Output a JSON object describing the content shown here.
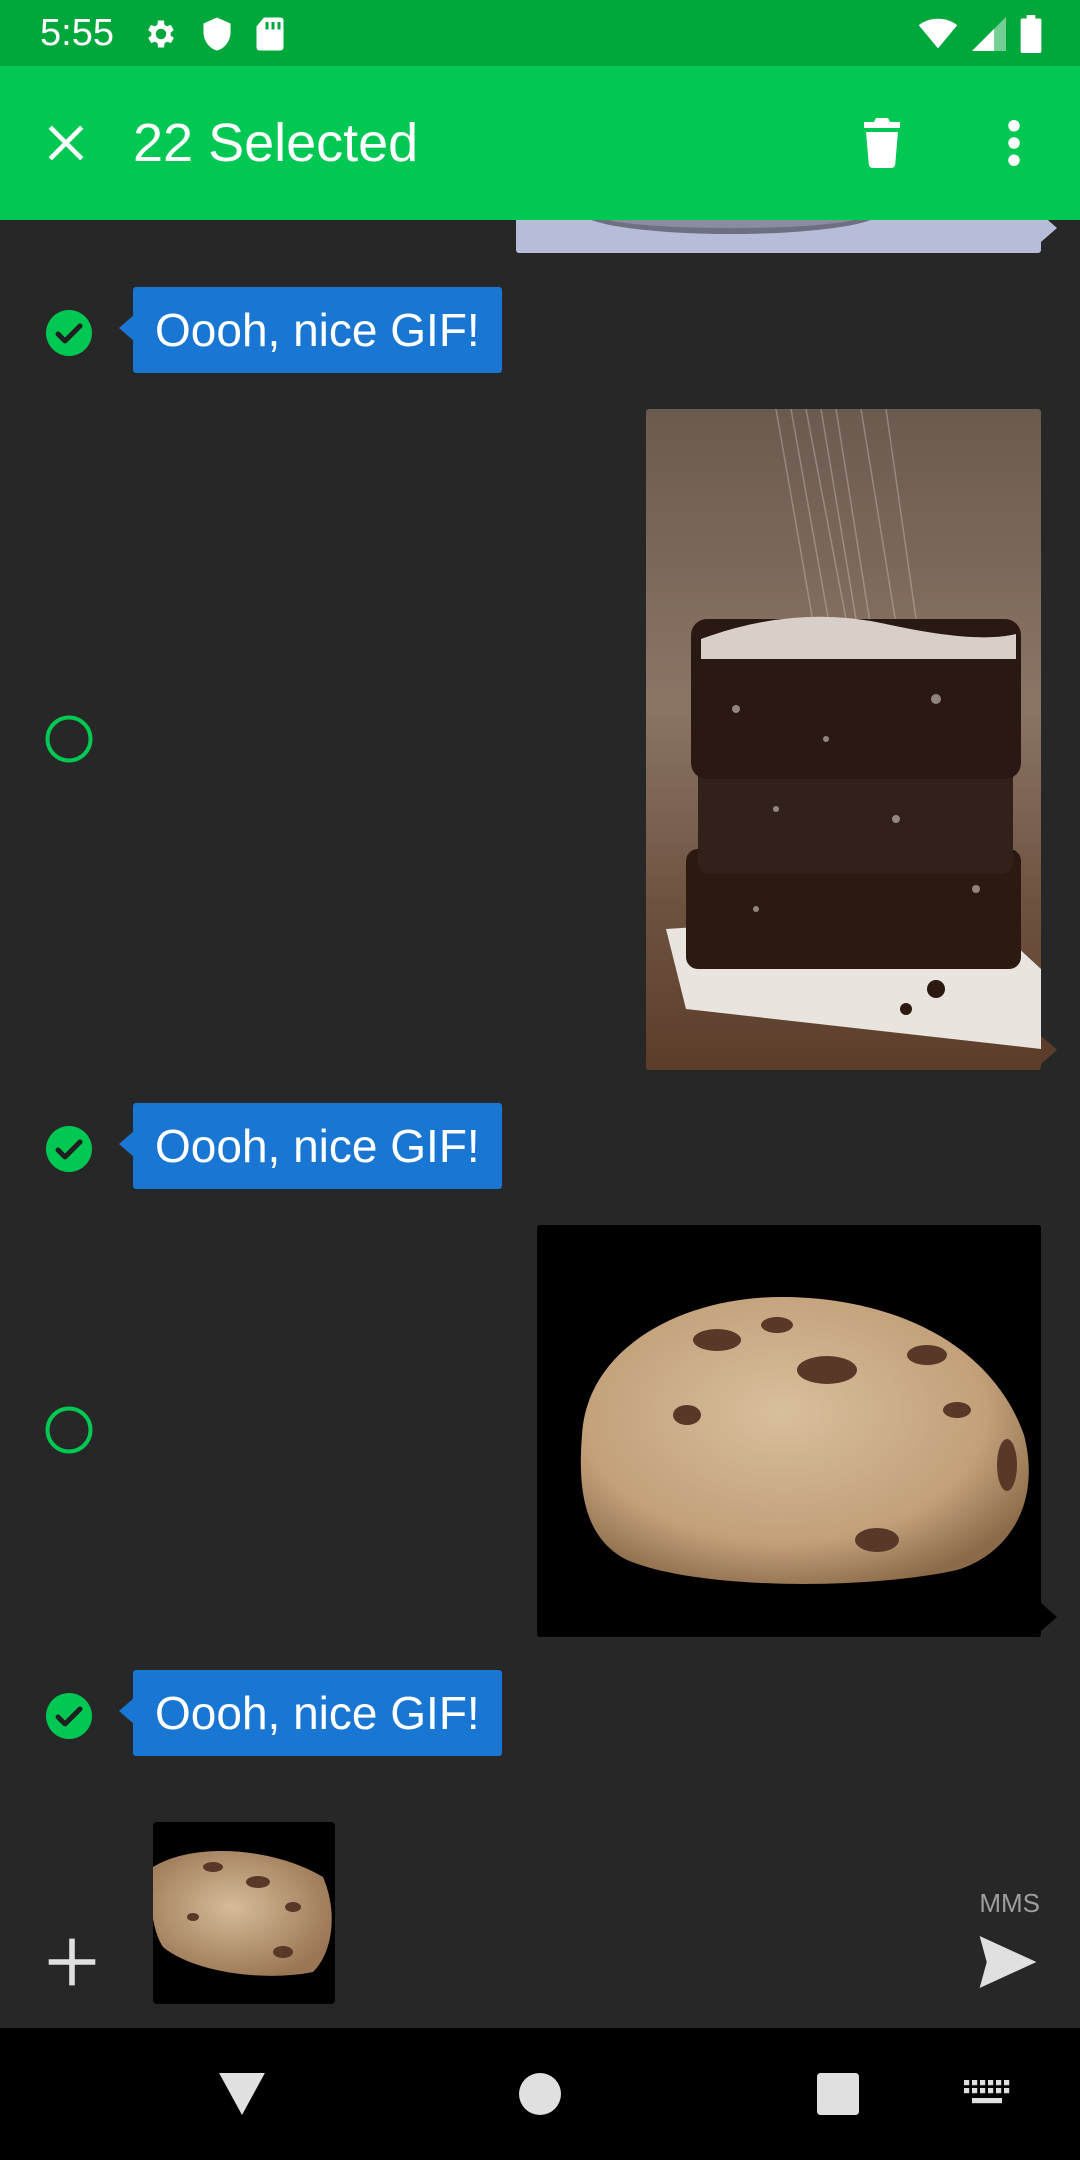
{
  "status_bar": {
    "time": "5:55",
    "left_icons": [
      "gear-icon",
      "shield-icon",
      "sd-card-icon"
    ],
    "right_icons": [
      "wifi-icon",
      "cell-signal-icon",
      "battery-icon"
    ],
    "background_color": "#00a83c"
  },
  "app_bar": {
    "title": "22 Selected",
    "close_icon": "close-icon",
    "delete_icon": "trash-icon",
    "more_icon": "more-vert-icon",
    "background_color": "#00c853"
  },
  "conversation": {
    "background_color": "#272727",
    "bubble_color": "#1976d2",
    "check_color": "#00c853",
    "messages": [
      {
        "type": "text",
        "text": "Oooh, nice GIF!",
        "selected": true
      },
      {
        "type": "image",
        "subject": "stacked brownies dusted with powdered sugar",
        "selected": false
      },
      {
        "type": "text",
        "text": "Oooh, nice GIF!",
        "selected": true
      },
      {
        "type": "image",
        "subject": "chocolate chip cookie",
        "selected": false
      },
      {
        "type": "text",
        "text": "Oooh, nice GIF!",
        "selected": true
      }
    ]
  },
  "compose": {
    "add_icon": "plus-icon",
    "attachment": "chocolate chip cookie thumbnail",
    "mode_label": "MMS",
    "send_icon": "send-icon"
  },
  "nav_bar": {
    "back_icon": "back-triangle-icon",
    "home_icon": "home-circle-icon",
    "recents_icon": "recents-square-icon",
    "keyboard_icon": "keyboard-icon"
  }
}
